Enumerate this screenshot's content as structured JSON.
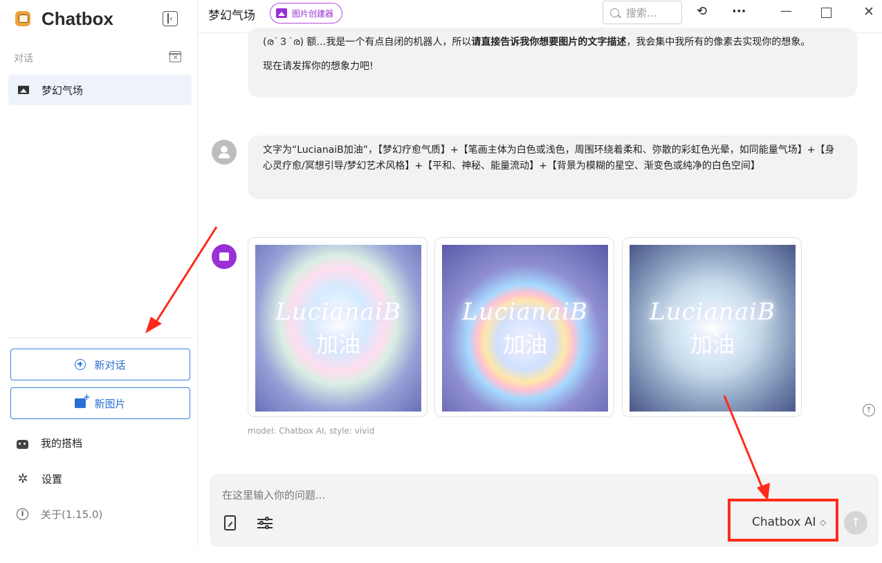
{
  "sidebar": {
    "brand": "Chatbox",
    "section_label": "对话",
    "conversations": [
      {
        "label": "梦幻气场"
      }
    ],
    "new_chat": "新对话",
    "new_image": "新图片",
    "menu": [
      {
        "label": "我的搭档",
        "icon": "robot-icon"
      },
      {
        "label": "设置",
        "icon": "gear-icon"
      },
      {
        "label": "关于(1.15.0)",
        "icon": "info-icon"
      }
    ]
  },
  "header": {
    "title": "梦幻气场",
    "chip_label": "图片创建器",
    "search_placeholder": "搜索..."
  },
  "messages": {
    "assistant_intro_line1_a": "(ര˙３˙ര) 额…我是一个有点自闭的机器人，所以",
    "assistant_intro_line1_bold": "请直接告诉我你想要图片的文字描述",
    "assistant_intro_line1_b": "，我会集中我所有的像素去实现你的想象。",
    "assistant_intro_line2": "现在请发挥你的想象力吧!",
    "user_prompt": "文字为“LucianaiB加油”，【梦幻疗愈气质】+【笔画主体为白色或浅色，周围环绕着柔和、弥散的彩虹色光晕，如同能量气场】+【身心灵疗愈/冥想引导/梦幻艺术风格】+【平和、神秘、能量流动】+【背景为模糊的星空、渐变色或纯净的白色空间】",
    "images": [
      {
        "text": "LucianaiB",
        "sub": "加油"
      },
      {
        "text": "LucianaiB",
        "sub": "加油"
      },
      {
        "text": "LucianaiB",
        "sub": "加油"
      }
    ],
    "caption": "model: Chatbox AI, style: vivid"
  },
  "input": {
    "placeholder": "在这里输入你的问题...",
    "model": "Chatbox AI"
  },
  "colors": {
    "accent": "#2a6fd6",
    "image_accent": "#9b2fd6",
    "annotation": "#ff2a1a"
  }
}
